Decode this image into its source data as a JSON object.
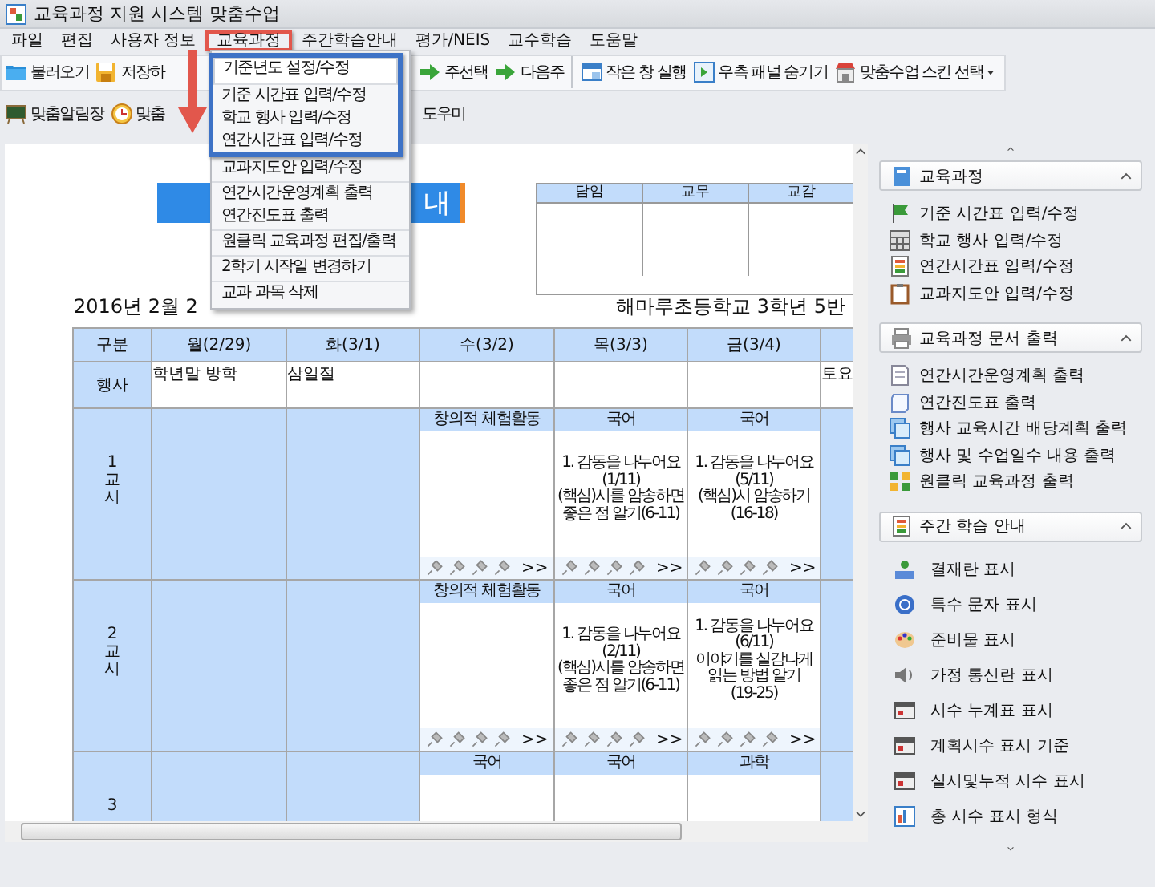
{
  "window": {
    "title": "교육과정 지원 시스템 맞춤수업"
  },
  "menu_bar": [
    {
      "label": "파일",
      "selected": false
    },
    {
      "label": "편집",
      "selected": false
    },
    {
      "label": "사용자 정보",
      "selected": false
    },
    {
      "label": "교육과정",
      "selected": true
    },
    {
      "label": "주간학습안내",
      "selected": false
    },
    {
      "label": "평가/NEIS",
      "selected": false
    },
    {
      "label": "교수학습",
      "selected": false
    },
    {
      "label": "도움말",
      "selected": false
    }
  ],
  "toolbar_1": {
    "left": [
      {
        "label": "불러오기"
      },
      {
        "label": "저장하"
      }
    ],
    "right": [
      {
        "label": "주선택"
      },
      {
        "label": "다음주",
        "separator_after": true
      },
      {
        "label": "작은 창 실행"
      },
      {
        "label": "우측 패널 숨기기"
      },
      {
        "label": "맞춤수업 스킨 선택",
        "dropdown": true
      }
    ]
  },
  "toolbar_2": {
    "left": [
      {
        "label": "맞춤알림장"
      },
      {
        "label": "맞춤"
      }
    ],
    "right": [
      {
        "label": "도우미"
      }
    ]
  },
  "dropdown": {
    "items": [
      {
        "label": "기준년도 설정/수정",
        "highlighted": true,
        "framed": true,
        "separator_after": true
      },
      {
        "label": "기준 시간표 입력/수정",
        "highlighted": false,
        "framed": true,
        "separator_after": false
      },
      {
        "label": "학교 행사 입력/수정",
        "highlighted": false,
        "framed": true,
        "separator_after": false
      },
      {
        "label": "연간시간표 입력/수정",
        "highlighted": false,
        "framed": true,
        "separator_after": false
      },
      {
        "label": "교과지도안 입력/수정",
        "highlighted": false,
        "framed": false,
        "separator_after": true
      },
      {
        "label": "연간시간운영계획 출력",
        "highlighted": false,
        "framed": false,
        "separator_after": false
      },
      {
        "label": "연간진도표 출력",
        "highlighted": false,
        "framed": false,
        "separator_after": true
      },
      {
        "label": "원클릭 교육과정 편집/출력",
        "highlighted": false,
        "framed": false,
        "separator_after": true
      },
      {
        "label": "2학기 시작일 변경하기",
        "highlighted": false,
        "framed": false,
        "separator_after": true
      },
      {
        "label": "교과 과목 삭제",
        "highlighted": false,
        "framed": false,
        "separator_after": false
      }
    ]
  },
  "document": {
    "banner": "내",
    "approval": [
      "담임",
      "교무",
      "교감"
    ],
    "date": "2016년 2월 2",
    "class_name": "해마루초등학교 3학년 5반",
    "timetable": {
      "columns": [
        "구분",
        "월(2/29)",
        "화(3/1)",
        "수(3/2)",
        "목(3/3)",
        "금(3/4)"
      ],
      "events": {
        "label": "행사",
        "cells": [
          {
            "text": "학년말 방학"
          },
          {
            "text": "삼일절"
          },
          {},
          {},
          {},
          {
            "text": "토요"
          }
        ]
      },
      "periods": [
        {
          "label": "1교시",
          "cells": [
            {
              "kind": "holiday"
            },
            {
              "kind": "holiday"
            },
            {
              "kind": "lesson",
              "subject": "창의적 체험활동",
              "more": ">>"
            },
            {
              "kind": "lesson",
              "subject": "국어",
              "content": "1. 감동을 나누어요\n(1/11)\n(핵심)시를 암송하면\n좋은 점 알기(6-11)",
              "more": ">>"
            },
            {
              "kind": "lesson",
              "subject": "국어",
              "content": "1. 감동을 나누어요\n(5/11)\n(핵심)시 암송하기\n(16-18)",
              "more": ">>"
            },
            {
              "kind": "holiday"
            }
          ]
        },
        {
          "label": "2교시",
          "cells": [
            {
              "kind": "holiday"
            },
            {
              "kind": "holiday"
            },
            {
              "kind": "lesson",
              "subject": "창의적 체험활동",
              "more": ">>"
            },
            {
              "kind": "lesson",
              "subject": "국어",
              "content": "1. 감동을 나누어요\n(2/11)\n(핵심)시를 암송하면\n좋은 점 알기(6-11)",
              "more": ">>"
            },
            {
              "kind": "lesson",
              "subject": "국어",
              "content": "1. 감동을 나누어요\n(6/11)\n이야기를 실감나게\n읽는 방법 알기\n(19-25)",
              "more": ">>"
            },
            {
              "kind": "holiday"
            }
          ]
        },
        {
          "label": "3",
          "cells": [
            {
              "kind": "holiday"
            },
            {
              "kind": "holiday"
            },
            {
              "kind": "lesson",
              "subject": "국어"
            },
            {
              "kind": "lesson",
              "subject": "국어"
            },
            {
              "kind": "lesson",
              "subject": "과학"
            },
            {
              "kind": "holiday"
            }
          ]
        }
      ]
    }
  },
  "side_panel": [
    {
      "title": "교육과정",
      "expanded": true,
      "items": [
        "기준 시간표 입력/수정",
        "학교 행사 입력/수정",
        "연간시간표 입력/수정",
        "교과지도안 입력/수정"
      ]
    },
    {
      "title": "교육과정 문서 출력",
      "expanded": true,
      "items": [
        "연간시간운영계획 출력",
        "연간진도표 출력",
        "행사 교육시간 배당계획 출력",
        "행사 및 수업일수 내용 출력",
        "원클릭 교육과정 출력"
      ]
    },
    {
      "title": "주간 학습 안내",
      "expanded": true,
      "items": [
        "결재란 표시",
        "특수 문자 표시",
        "준비물 표시",
        "가정 통신란 표시",
        "시수 누계표 표시",
        "계획시수 표시 기준",
        "실시및누적 시수 표시",
        "총 시수 표시 형식"
      ]
    }
  ]
}
